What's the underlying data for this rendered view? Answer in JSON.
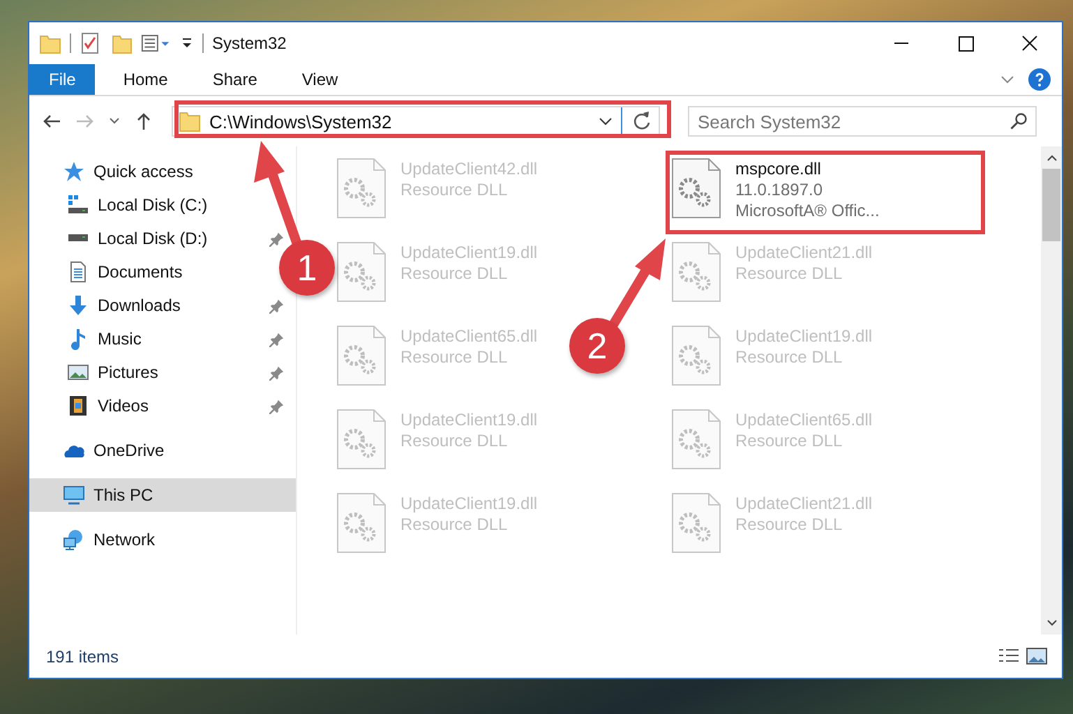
{
  "window": {
    "title": "System32"
  },
  "ribbon_tabs": [
    {
      "label": "File",
      "kind": "file"
    },
    {
      "label": "Home",
      "kind": "tab"
    },
    {
      "label": "Share",
      "kind": "tab"
    },
    {
      "label": "View",
      "kind": "tab"
    }
  ],
  "address_bar": {
    "path": "C:\\Windows\\System32"
  },
  "search": {
    "placeholder": "Search System32"
  },
  "sidebar": {
    "items": [
      {
        "label": "Quick access",
        "selected": false,
        "children": [
          {
            "label": "Local Disk (C:)",
            "pinned": false
          },
          {
            "label": "Local Disk (D:)",
            "pinned": true
          },
          {
            "label": "Documents",
            "pinned": false
          },
          {
            "label": "Downloads",
            "pinned": true
          },
          {
            "label": "Music",
            "pinned": true
          },
          {
            "label": "Pictures",
            "pinned": true
          },
          {
            "label": "Videos",
            "pinned": true
          }
        ]
      },
      {
        "label": "OneDrive",
        "selected": false
      },
      {
        "label": "This PC",
        "selected": true
      },
      {
        "label": "Network",
        "selected": false
      }
    ]
  },
  "files": [
    {
      "name": "UpdateClient42.dll",
      "lines": [
        "Resource DLL"
      ],
      "blurred": true
    },
    {
      "name": "mspcore.dll",
      "lines": [
        "11.0.1897.0",
        "MicrosoftA® Offic..."
      ],
      "blurred": false
    },
    {
      "name": "UpdateClient19.dll",
      "lines": [
        "Resource DLL"
      ],
      "blurred": true
    },
    {
      "name": "UpdateClient21.dll",
      "lines": [
        "Resource DLL"
      ],
      "blurred": true
    },
    {
      "name": "UpdateClient65.dll",
      "lines": [
        "Resource DLL"
      ],
      "blurred": true
    },
    {
      "name": "UpdateClient19.dll",
      "lines": [
        "Resource DLL"
      ],
      "blurred": true
    },
    {
      "name": "UpdateClient19.dll",
      "lines": [
        "Resource DLL"
      ],
      "blurred": true
    },
    {
      "name": "UpdateClient65.dll",
      "lines": [
        "Resource DLL"
      ],
      "blurred": true
    },
    {
      "name": "UpdateClient19.dll",
      "lines": [
        "Resource DLL"
      ],
      "blurred": true
    },
    {
      "name": "UpdateClient21.dll",
      "lines": [
        "Resource DLL"
      ],
      "blurred": true
    }
  ],
  "status_bar": {
    "count": "191 items"
  },
  "annotations": [
    {
      "number": "1"
    },
    {
      "number": "2"
    }
  ]
}
